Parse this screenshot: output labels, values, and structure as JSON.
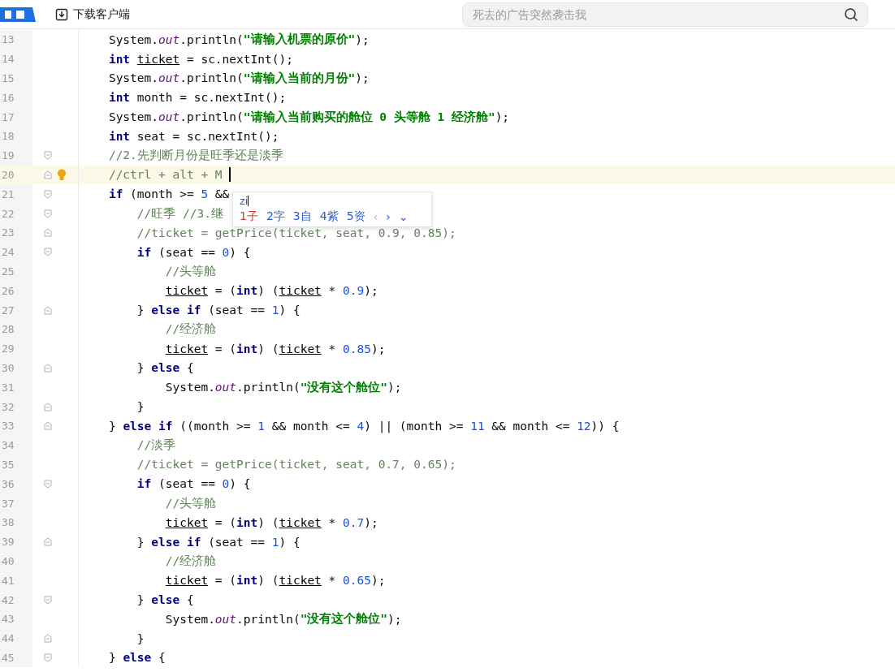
{
  "header": {
    "download_label": "下载客户端",
    "search": {
      "placeholder": "死去的广告突然袭击我"
    }
  },
  "editor": {
    "lines": [
      {
        "number": "13",
        "kind": "single",
        "fold_start": false,
        "fold_end": false,
        "current": false,
        "tokens": [
          {
            "kind": "plain",
            "text": "System."
          },
          {
            "kind": "field",
            "text": "out"
          },
          {
            "kind": "plain",
            "text": ".println("
          },
          {
            "kind": "string",
            "text": "\"请输入机票的原价\""
          },
          {
            "kind": "plain",
            "text": ");"
          }
        ]
      },
      {
        "number": "14",
        "kind": "single",
        "fold_start": false,
        "fold_end": false,
        "current": false,
        "tokens": [
          {
            "kind": "keyword",
            "text": "int "
          },
          {
            "kind": "var",
            "text": "ticket"
          },
          {
            "kind": "plain",
            "text": " = sc.nextInt();"
          }
        ]
      },
      {
        "number": "15",
        "kind": "single",
        "fold_start": false,
        "fold_end": false,
        "current": false,
        "tokens": [
          {
            "kind": "plain",
            "text": "System."
          },
          {
            "kind": "field",
            "text": "out"
          },
          {
            "kind": "plain",
            "text": ".println("
          },
          {
            "kind": "string",
            "text": "\"请输入当前的月份\""
          },
          {
            "kind": "plain",
            "text": ");"
          }
        ]
      },
      {
        "number": "16",
        "kind": "single",
        "fold_start": false,
        "fold_end": false,
        "current": false,
        "tokens": [
          {
            "kind": "keyword",
            "text": "int"
          },
          {
            "kind": "plain",
            "text": " month = sc.nextInt();"
          }
        ]
      },
      {
        "number": "17",
        "kind": "single",
        "fold_start": false,
        "fold_end": false,
        "current": false,
        "tokens": [
          {
            "kind": "plain",
            "text": "System."
          },
          {
            "kind": "field",
            "text": "out"
          },
          {
            "kind": "plain",
            "text": ".println("
          },
          {
            "kind": "string",
            "text": "\"请输入当前购买的舱位 0 头等舱 1 经济舱\""
          },
          {
            "kind": "plain",
            "text": ");"
          }
        ]
      },
      {
        "number": "18",
        "kind": "single",
        "fold_start": false,
        "fold_end": false,
        "current": false,
        "tokens": [
          {
            "kind": "keyword",
            "text": "int"
          },
          {
            "kind": "plain",
            "text": " seat = sc.nextInt();"
          }
        ]
      },
      {
        "number": "19",
        "kind": "single",
        "fold_start": true,
        "fold_end": false,
        "current": false,
        "tokens": [
          {
            "kind": "comment",
            "text": "//2.先判断月份是旺季还是淡季"
          }
        ]
      },
      {
        "number": "20",
        "kind": "single",
        "fold_start": false,
        "fold_end": true,
        "current": true,
        "hint": true,
        "tokens": [
          {
            "kind": "comment",
            "text": "//ctrl + alt + M "
          }
        ]
      },
      {
        "number": "21",
        "kind": "single",
        "fold_start": true,
        "fold_end": false,
        "current": false,
        "tokens": [
          {
            "kind": "keyword",
            "text": "if"
          },
          {
            "kind": "plain",
            "text": " (month >= "
          },
          {
            "kind": "number",
            "text": "5"
          },
          {
            "kind": "plain",
            "text": " &&"
          }
        ]
      },
      {
        "number": "22",
        "kind": "double",
        "fold_start": true,
        "fold_end": false,
        "current": false,
        "tokens": [
          {
            "kind": "comment",
            "text": "//旺季 //3.继"
          }
        ]
      },
      {
        "number": "23",
        "kind": "double",
        "fold_start": false,
        "fold_end": true,
        "current": false,
        "tokens": [
          {
            "kind": "comment",
            "text": "//ticket = getPrice(ticket, seat, 0.9, 0.85);"
          }
        ]
      },
      {
        "number": "24",
        "kind": "double",
        "fold_start": true,
        "fold_end": false,
        "current": false,
        "tokens": [
          {
            "kind": "keyword",
            "text": "if"
          },
          {
            "kind": "plain",
            "text": " (seat == "
          },
          {
            "kind": "number",
            "text": "0"
          },
          {
            "kind": "plain",
            "text": ") {"
          }
        ]
      },
      {
        "number": "25",
        "kind": "triple",
        "fold_start": false,
        "fold_end": false,
        "current": false,
        "tokens": [
          {
            "kind": "comment",
            "text": "//头等舱"
          }
        ]
      },
      {
        "number": "26",
        "kind": "triple",
        "fold_start": false,
        "fold_end": false,
        "current": false,
        "tokens": [
          {
            "kind": "var",
            "text": "ticket"
          },
          {
            "kind": "plain",
            "text": " = ("
          },
          {
            "kind": "keyword",
            "text": "int"
          },
          {
            "kind": "plain",
            "text": ") ("
          },
          {
            "kind": "var",
            "text": "ticket"
          },
          {
            "kind": "plain",
            "text": " * "
          },
          {
            "kind": "number",
            "text": "0.9"
          },
          {
            "kind": "plain",
            "text": ");"
          }
        ]
      },
      {
        "number": "27",
        "kind": "double",
        "fold_start": false,
        "fold_end": true,
        "current": false,
        "tokens": [
          {
            "kind": "plain",
            "text": "} "
          },
          {
            "kind": "keyword",
            "text": "else if"
          },
          {
            "kind": "plain",
            "text": " (seat == "
          },
          {
            "kind": "number",
            "text": "1"
          },
          {
            "kind": "plain",
            "text": ") {"
          }
        ]
      },
      {
        "number": "28",
        "kind": "triple",
        "fold_start": false,
        "fold_end": false,
        "current": false,
        "tokens": [
          {
            "kind": "comment",
            "text": "//经济舱"
          }
        ]
      },
      {
        "number": "29",
        "kind": "triple",
        "fold_start": false,
        "fold_end": false,
        "current": false,
        "tokens": [
          {
            "kind": "var",
            "text": "ticket"
          },
          {
            "kind": "plain",
            "text": " = ("
          },
          {
            "kind": "keyword",
            "text": "int"
          },
          {
            "kind": "plain",
            "text": ") ("
          },
          {
            "kind": "var",
            "text": "ticket"
          },
          {
            "kind": "plain",
            "text": " * "
          },
          {
            "kind": "number",
            "text": "0.85"
          },
          {
            "kind": "plain",
            "text": ");"
          }
        ]
      },
      {
        "number": "30",
        "kind": "double",
        "fold_start": false,
        "fold_end": true,
        "current": false,
        "tokens": [
          {
            "kind": "plain",
            "text": "} "
          },
          {
            "kind": "keyword",
            "text": "else"
          },
          {
            "kind": "plain",
            "text": " {"
          }
        ]
      },
      {
        "number": "31",
        "kind": "triple",
        "fold_start": false,
        "fold_end": false,
        "current": false,
        "tokens": [
          {
            "kind": "plain",
            "text": "System."
          },
          {
            "kind": "field",
            "text": "out"
          },
          {
            "kind": "plain",
            "text": ".println("
          },
          {
            "kind": "string",
            "text": "\"没有这个舱位\""
          },
          {
            "kind": "plain",
            "text": ");"
          }
        ]
      },
      {
        "number": "32",
        "kind": "double",
        "fold_start": false,
        "fold_end": true,
        "current": false,
        "tokens": [
          {
            "kind": "plain",
            "text": "}"
          }
        ]
      },
      {
        "number": "33",
        "kind": "single",
        "fold_start": false,
        "fold_end": true,
        "current": false,
        "tokens": [
          {
            "kind": "plain",
            "text": "} "
          },
          {
            "kind": "keyword",
            "text": "else if"
          },
          {
            "kind": "plain",
            "text": " ((month >= "
          },
          {
            "kind": "number",
            "text": "1"
          },
          {
            "kind": "plain",
            "text": " && month <= "
          },
          {
            "kind": "number",
            "text": "4"
          },
          {
            "kind": "plain",
            "text": ") || (month >= "
          },
          {
            "kind": "number",
            "text": "11"
          },
          {
            "kind": "plain",
            "text": " && month <= "
          },
          {
            "kind": "number",
            "text": "12"
          },
          {
            "kind": "plain",
            "text": ")) {"
          }
        ]
      },
      {
        "number": "34",
        "kind": "double",
        "fold_start": false,
        "fold_end": false,
        "current": false,
        "tokens": [
          {
            "kind": "comment",
            "text": "//淡季"
          }
        ]
      },
      {
        "number": "35",
        "kind": "double",
        "fold_start": false,
        "fold_end": false,
        "current": false,
        "tokens": [
          {
            "kind": "comment",
            "text": "//ticket = getPrice(ticket, seat, 0.7, 0.65);"
          }
        ]
      },
      {
        "number": "36",
        "kind": "double",
        "fold_start": true,
        "fold_end": false,
        "current": false,
        "tokens": [
          {
            "kind": "keyword",
            "text": "if"
          },
          {
            "kind": "plain",
            "text": " (seat == "
          },
          {
            "kind": "number",
            "text": "0"
          },
          {
            "kind": "plain",
            "text": ") {"
          }
        ]
      },
      {
        "number": "37",
        "kind": "triple",
        "fold_start": false,
        "fold_end": false,
        "current": false,
        "tokens": [
          {
            "kind": "comment",
            "text": "//头等舱"
          }
        ]
      },
      {
        "number": "38",
        "kind": "triple",
        "fold_start": false,
        "fold_end": false,
        "current": false,
        "tokens": [
          {
            "kind": "var",
            "text": "ticket"
          },
          {
            "kind": "plain",
            "text": " = ("
          },
          {
            "kind": "keyword",
            "text": "int"
          },
          {
            "kind": "plain",
            "text": ") ("
          },
          {
            "kind": "var",
            "text": "ticket"
          },
          {
            "kind": "plain",
            "text": " * "
          },
          {
            "kind": "number",
            "text": "0.7"
          },
          {
            "kind": "plain",
            "text": ");"
          }
        ]
      },
      {
        "number": "39",
        "kind": "double",
        "fold_start": false,
        "fold_end": true,
        "current": false,
        "tokens": [
          {
            "kind": "plain",
            "text": "} "
          },
          {
            "kind": "keyword",
            "text": "else if"
          },
          {
            "kind": "plain",
            "text": " (seat == "
          },
          {
            "kind": "number",
            "text": "1"
          },
          {
            "kind": "plain",
            "text": ") {"
          }
        ]
      },
      {
        "number": "40",
        "kind": "triple",
        "fold_start": false,
        "fold_end": false,
        "current": false,
        "tokens": [
          {
            "kind": "comment",
            "text": "//经济舱"
          }
        ]
      },
      {
        "number": "41",
        "kind": "triple",
        "fold_start": false,
        "fold_end": false,
        "current": false,
        "tokens": [
          {
            "kind": "var",
            "text": "ticket"
          },
          {
            "kind": "plain",
            "text": " = ("
          },
          {
            "kind": "keyword",
            "text": "int"
          },
          {
            "kind": "plain",
            "text": ") ("
          },
          {
            "kind": "var",
            "text": "ticket"
          },
          {
            "kind": "plain",
            "text": " * "
          },
          {
            "kind": "number",
            "text": "0.65"
          },
          {
            "kind": "plain",
            "text": ");"
          }
        ]
      },
      {
        "number": "42",
        "kind": "double",
        "fold_start": true,
        "fold_end": false,
        "current": false,
        "tokens": [
          {
            "kind": "plain",
            "text": "} "
          },
          {
            "kind": "keyword",
            "text": "else"
          },
          {
            "kind": "plain",
            "text": " {"
          }
        ]
      },
      {
        "number": "43",
        "kind": "triple",
        "fold_start": false,
        "fold_end": false,
        "current": false,
        "tokens": [
          {
            "kind": "plain",
            "text": "System."
          },
          {
            "kind": "field",
            "text": "out"
          },
          {
            "kind": "plain",
            "text": ".println("
          },
          {
            "kind": "string",
            "text": "\"没有这个舱位\""
          },
          {
            "kind": "plain",
            "text": ");"
          }
        ]
      },
      {
        "number": "44",
        "kind": "double",
        "fold_start": false,
        "fold_end": true,
        "current": false,
        "tokens": [
          {
            "kind": "plain",
            "text": "}"
          }
        ]
      },
      {
        "number": "45",
        "kind": "single",
        "fold_start": true,
        "fold_end": false,
        "current": false,
        "tokens": [
          {
            "kind": "plain",
            "text": "} "
          },
          {
            "kind": "keyword",
            "text": "else"
          },
          {
            "kind": "plain",
            "text": " {"
          }
        ]
      }
    ]
  },
  "ime_popup": {
    "input": "zi",
    "candidates": [
      {
        "index": "1",
        "text": "子",
        "selected": true
      },
      {
        "index": "2",
        "text": "字",
        "selected": false
      },
      {
        "index": "3",
        "text": "自",
        "selected": false
      },
      {
        "index": "4",
        "text": "紫",
        "selected": false
      },
      {
        "index": "5",
        "text": "资",
        "selected": false
      }
    ],
    "prev": "‹",
    "next": "›",
    "expand": "⌄"
  }
}
